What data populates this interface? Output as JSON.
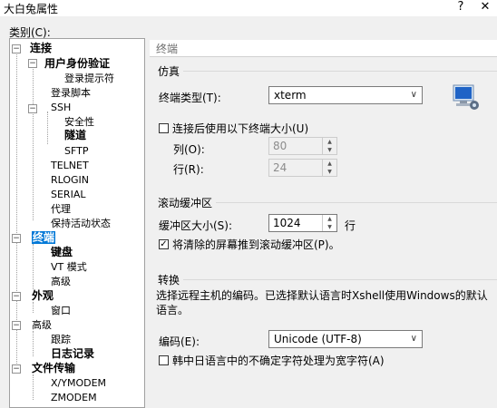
{
  "window": {
    "title": "大白兔属性",
    "help": "?",
    "close": "✕"
  },
  "category_label": "类别(C):",
  "tree": [
    {
      "label": "连接",
      "bold": true
    },
    {
      "label": "用户身份验证",
      "bold": true
    },
    {
      "label": "登录提示符",
      "bold": false
    },
    {
      "label": "登录脚本",
      "bold": false
    },
    {
      "label": "SSH",
      "bold": false
    },
    {
      "label": "安全性",
      "bold": false
    },
    {
      "label": "隧道",
      "bold": true
    },
    {
      "label": "SFTP",
      "bold": false
    },
    {
      "label": "TELNET",
      "bold": false
    },
    {
      "label": "RLOGIN",
      "bold": false
    },
    {
      "label": "SERIAL",
      "bold": false
    },
    {
      "label": "代理",
      "bold": false
    },
    {
      "label": "保持活动状态",
      "bold": false
    },
    {
      "label": "终端",
      "bold": true,
      "selected": true
    },
    {
      "label": "键盘",
      "bold": true
    },
    {
      "label": "VT 模式",
      "bold": false
    },
    {
      "label": "高级",
      "bold": false
    },
    {
      "label": "外观",
      "bold": true
    },
    {
      "label": "窗口",
      "bold": false
    },
    {
      "label": "高级",
      "bold": false
    },
    {
      "label": "跟踪",
      "bold": false
    },
    {
      "label": "日志记录",
      "bold": true
    },
    {
      "label": "文件传输",
      "bold": true
    },
    {
      "label": "X/YMODEM",
      "bold": false
    },
    {
      "label": "ZMODEM",
      "bold": false
    }
  ],
  "panel": {
    "header": "终端",
    "emulation": {
      "title": "仿真",
      "terminal_type_label": "终端类型(T):",
      "terminal_type_value": "xterm",
      "custom_size_label": "连接后使用以下终端大小(U)",
      "custom_size_checked": false,
      "cols_label": "列(O):",
      "cols_value": "80",
      "rows_label": "行(R):",
      "rows_value": "24"
    },
    "scrollback": {
      "title": "滚动缓冲区",
      "size_label": "缓冲区大小(S):",
      "size_value": "1024",
      "size_unit": "行",
      "push_label": "将清除的屏幕推到滚动缓冲区(P)。",
      "push_checked": true
    },
    "conversion": {
      "title": "转换",
      "description": "选择远程主机的编码。已选择默认语言时Xshell使用Windows的默认语言。",
      "encoding_label": "编码(E):",
      "encoding_value": "Unicode (UTF-8)",
      "cjk_label": "韩中日语言中的不确定字符处理为宽字符(A)",
      "cjk_checked": false
    }
  }
}
